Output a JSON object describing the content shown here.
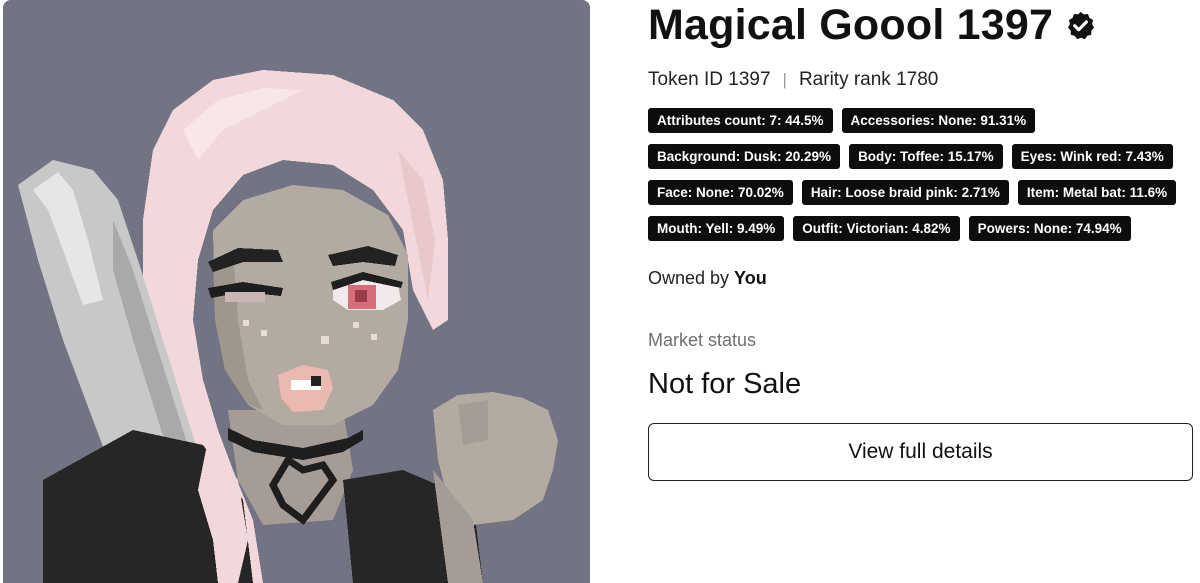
{
  "nft": {
    "title": "Magical Goool 1397",
    "verified_icon": "verified-badge-icon",
    "token_id": "Token ID 1397",
    "rarity_rank": "Rarity rank 1780",
    "separator": "|"
  },
  "attributes": [
    [
      "Attributes count: 7: 44.5%",
      "Accessories: None: 91.31%"
    ],
    [
      "Background: Dusk: 20.29%",
      "Body: Toffee: 15.17%",
      "Eyes: Wink red: 7.43%"
    ],
    [
      "Face: None: 70.02%",
      "Hair: Loose braid pink: 2.71%",
      "Item: Metal bat: 11.6%"
    ],
    [
      "Mouth: Yell: 9.49%",
      "Outfit: Victorian: 4.82%",
      "Powers: None: 74.94%"
    ]
  ],
  "ownership": {
    "prefix": "Owned by",
    "owner": "You"
  },
  "market": {
    "label": "Market status",
    "status": "Not for Sale"
  },
  "actions": {
    "view_details_label": "View full details"
  },
  "colors": {
    "background_dusk": "#727383",
    "hair_pink": "#f2d8da",
    "skin_toffee": "#b3aaa2",
    "tag_bg": "#0d0d0d",
    "bat_grey": "#c8c8c8",
    "outfit_black": "#262626"
  }
}
